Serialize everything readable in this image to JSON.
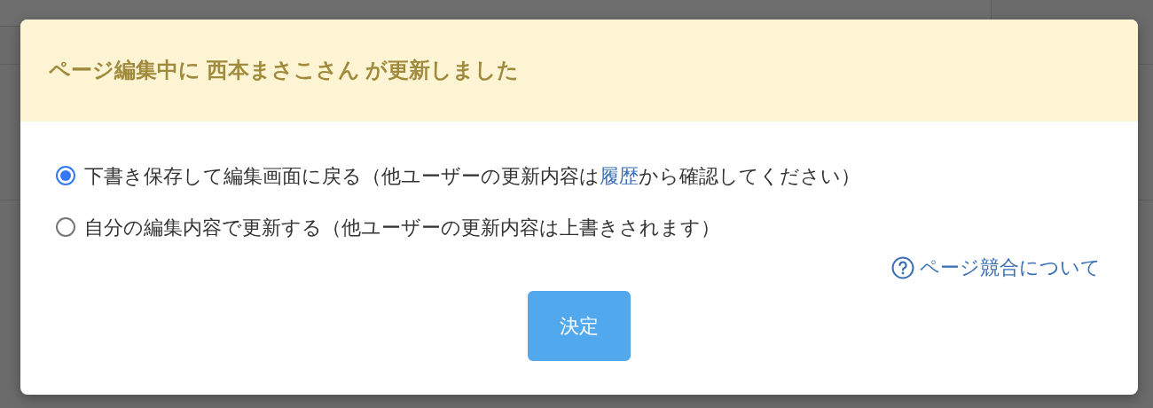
{
  "dialog": {
    "title": "ページ編集中に 西本まさこさん が更新しました",
    "options": [
      {
        "selected": true,
        "segments": [
          {
            "kind": "text",
            "text": "下書き保存して編集画面に戻る（他ユーザーの更新内容は"
          },
          {
            "kind": "link",
            "text": "履歴"
          },
          {
            "kind": "text",
            "text": "から確認してください）"
          }
        ]
      },
      {
        "selected": false,
        "segments": [
          {
            "kind": "text",
            "text": "自分の編集内容で更新する（他ユーザーの更新内容は上書きされます）"
          }
        ]
      }
    ],
    "help_link": "ページ競合について",
    "submit_button": "決定"
  }
}
